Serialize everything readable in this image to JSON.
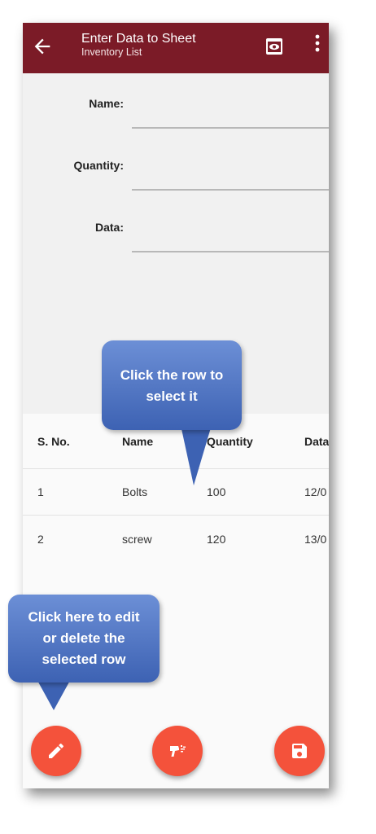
{
  "app_bar": {
    "title": "Enter Data to Sheet",
    "subtitle": "Inventory List",
    "color": "#7b1b27"
  },
  "form": {
    "name_label": "Name:",
    "quantity_label": "Quantity:",
    "data_label": "Data:"
  },
  "table": {
    "headers": [
      "S. No.",
      "Name",
      "Quantity",
      "Data"
    ],
    "rows": [
      {
        "sno": "1",
        "name": "Bolts",
        "quantity": "100",
        "data": "12/0"
      },
      {
        "sno": "2",
        "name": "screw",
        "quantity": "120",
        "data": "13/0"
      }
    ]
  },
  "callouts": {
    "select_row": "Click the row to select it",
    "edit_delete": "Click here to edit or delete the selected row"
  },
  "fabs": {
    "color": "#f4523b",
    "icons": [
      "pencil-icon",
      "barcode-scanner-icon",
      "save-icon"
    ]
  }
}
